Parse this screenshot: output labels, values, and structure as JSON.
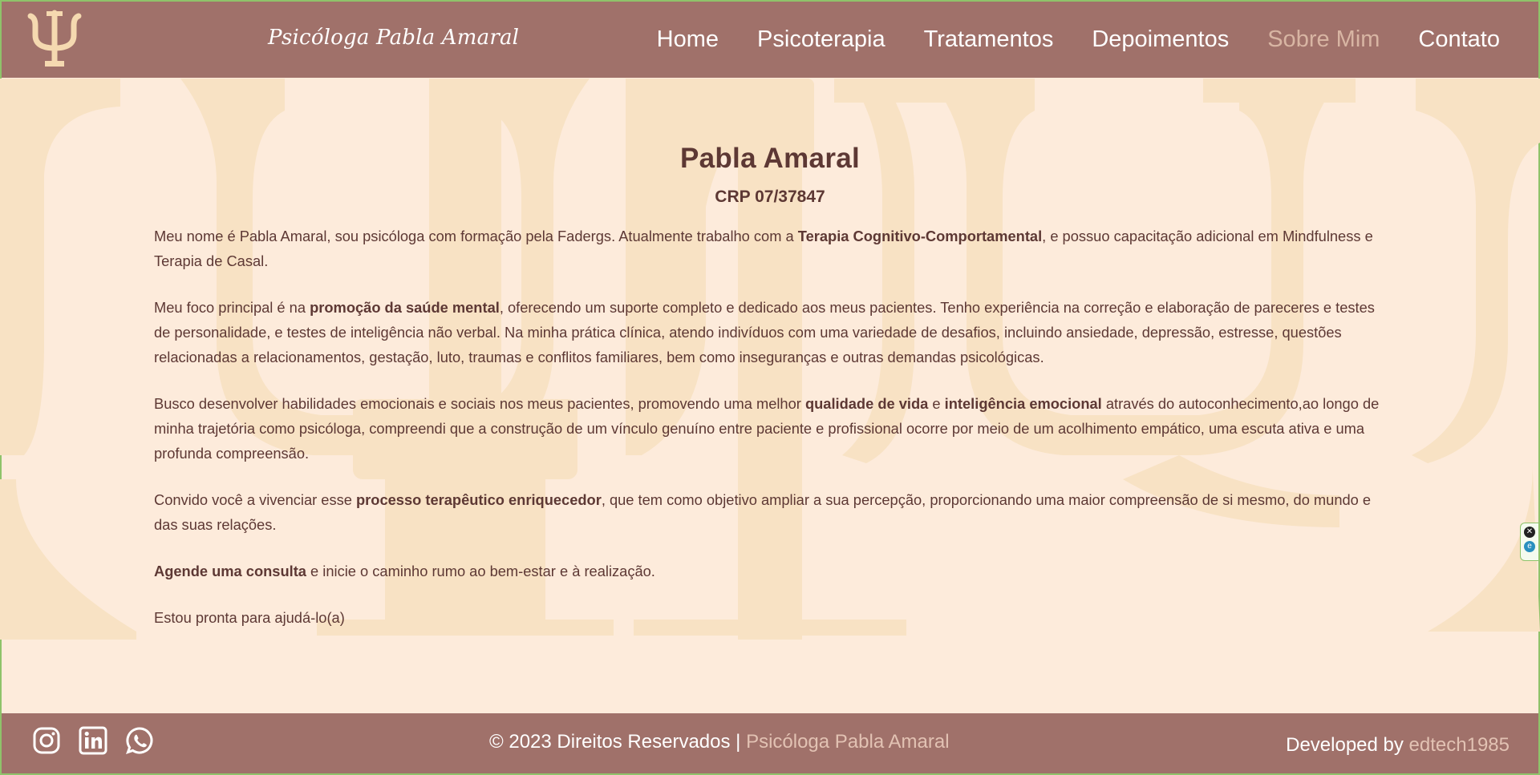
{
  "header": {
    "logo_icon": "psi-icon",
    "brand": "Psicóloga Pabla Amaral",
    "nav": [
      {
        "label": "Home",
        "active": false
      },
      {
        "label": "Psicoterapia",
        "active": false
      },
      {
        "label": "Tratamentos",
        "active": false
      },
      {
        "label": "Depoimentos",
        "active": false
      },
      {
        "label": "Sobre Mim",
        "active": true
      },
      {
        "label": "Contato",
        "active": false
      }
    ]
  },
  "main": {
    "title": "Pabla Amaral",
    "crp": "CRP 07/37847",
    "p1": {
      "a": "Meu nome é Pabla Amaral, sou psicóloga com formação pela Fadergs. Atualmente trabalho com a ",
      "b": "Terapia Cognitivo-Comportamental",
      "c": ", e possuo capacitação adicional em Mindfulness e Terapia de Casal."
    },
    "p2": {
      "a": "Meu foco principal é na ",
      "b": "promoção da saúde mental",
      "c": ", oferecendo um suporte completo e dedicado aos meus pacientes. Tenho experiência na correção e elaboração de pareceres e testes de personalidade, e testes de inteligência não verbal. Na minha prática clínica, atendo indivíduos com uma variedade de desafios, incluindo ansiedade, depressão, estresse, questões relacionadas a relacionamentos, gestação, luto, traumas e conflitos familiares, bem como inseguranças e outras demandas psicológicas."
    },
    "p3": {
      "a": "Busco desenvolver habilidades emocionais e sociais nos meus pacientes, promovendo uma melhor ",
      "b": "qualidade de vida",
      "c": " e ",
      "d": "inteligência emocional",
      "e": " através do autoconhecimento,ao longo de minha trajetória como psicóloga, compreendi que a construção de um vínculo genuíno entre paciente e profissional ocorre por meio de um acolhimento empático, uma escuta ativa e uma profunda compreensão."
    },
    "p4": {
      "a": "Convido você a vivenciar esse ",
      "b": "processo terapêutico enriquecedor",
      "c": ", que tem como objetivo ampliar a sua percepção, proporcionando uma maior compreensão de si mesmo, do mundo e das suas relações."
    },
    "p5": {
      "a": "Agende uma consulta",
      "b": " e inicie o caminho rumo ao bem-estar e à realização."
    },
    "p6": "Estou pronta para ajudá-lo(a)"
  },
  "footer": {
    "socials": [
      "instagram-icon",
      "linkedin-icon",
      "whatsapp-icon"
    ],
    "copyright_prefix": "© 2023 Direitos Reservados | ",
    "copyright_brand": "Psicóloga Pabla Amaral",
    "dev_prefix": "Developed by ",
    "dev_name": "edtech1985"
  },
  "colors": {
    "header_bg": "#a0716a",
    "page_bg": "#fdebdb",
    "watermark": "#f9e3c6",
    "logo": "#f5d9b0",
    "text": "#5d3834",
    "nav_active": "#d8b5a3"
  }
}
